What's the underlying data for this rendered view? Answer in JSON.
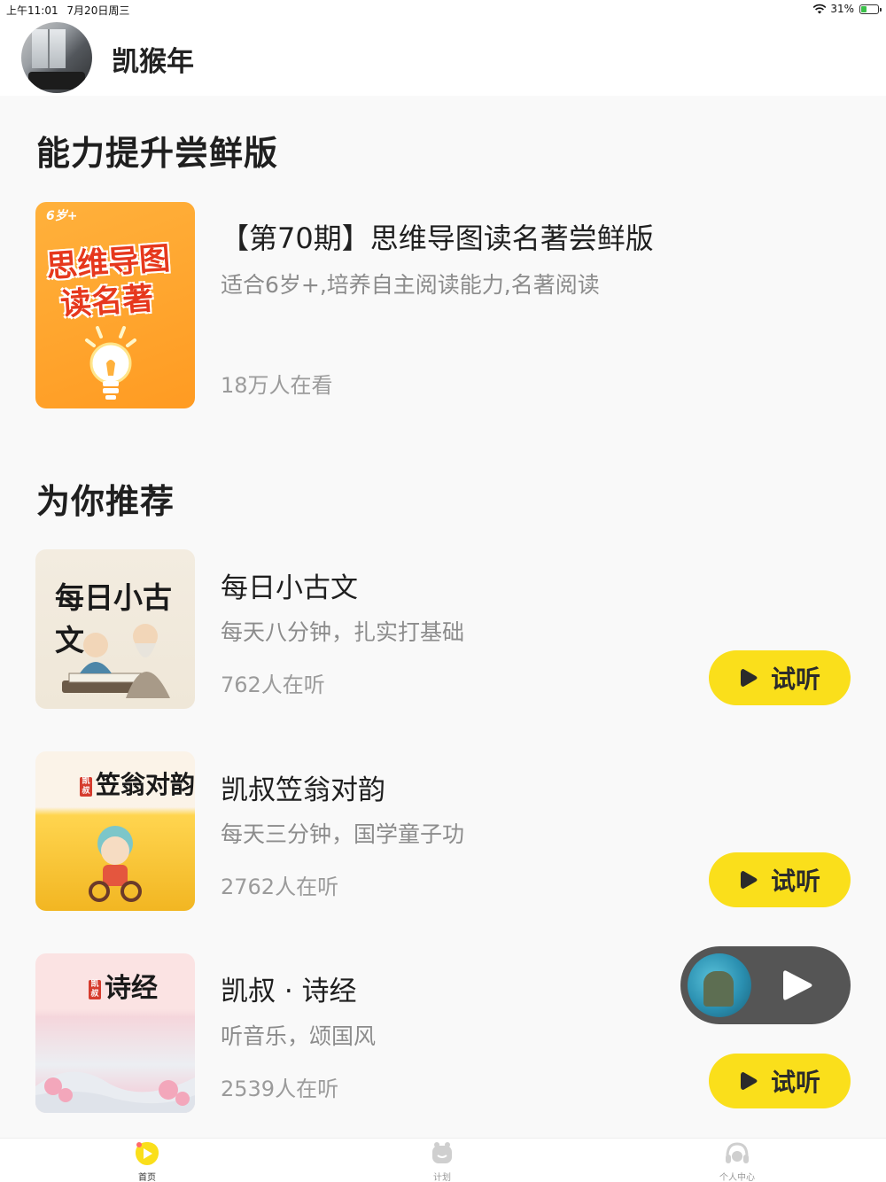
{
  "status_bar": {
    "time": "上午11:01",
    "date": "7月20日周三",
    "battery": "31%",
    "battery_level": 0.31
  },
  "header": {
    "username": "凯猴年"
  },
  "featured": {
    "section_title": "能力提升尝鲜版",
    "cover": {
      "age": "6岁+",
      "line1": "思维导图",
      "line2": "读名著"
    },
    "title": "【第70期】思维导图读名著尝鲜版",
    "subtitle": "适合6岁+,培养自主阅读能力,名著阅读",
    "viewers": "18万人在看"
  },
  "recommend": {
    "section_title": "为你推荐",
    "items": [
      {
        "cover_title": "每日小古文",
        "title": "每日小古文",
        "subtitle": "每天八分钟，扎实打基础",
        "listeners": "762人在听",
        "button": "试听"
      },
      {
        "cover_title": "笠翁对韵",
        "cover_seal": "凯叔",
        "title": "凯叔笠翁对韵",
        "subtitle": "每天三分钟，国学童子功",
        "listeners": "2762人在听",
        "button": "试听"
      },
      {
        "cover_title": "诗经",
        "cover_seal": "凯叔",
        "title": "凯叔 · 诗经",
        "subtitle": "听音乐，颂国风",
        "listeners": "2539人在听",
        "button": "试听"
      }
    ]
  },
  "tabbar": {
    "tabs": [
      {
        "label": "首页",
        "icon": "home-icon",
        "active": true
      },
      {
        "label": "计划",
        "icon": "plan-icon",
        "active": false
      },
      {
        "label": "个人中心",
        "icon": "profile-icon",
        "active": false
      }
    ]
  },
  "colors": {
    "accent_yellow": "#fadf1b",
    "player_bg": "#555555",
    "featured_orange": "#ff9b22"
  }
}
